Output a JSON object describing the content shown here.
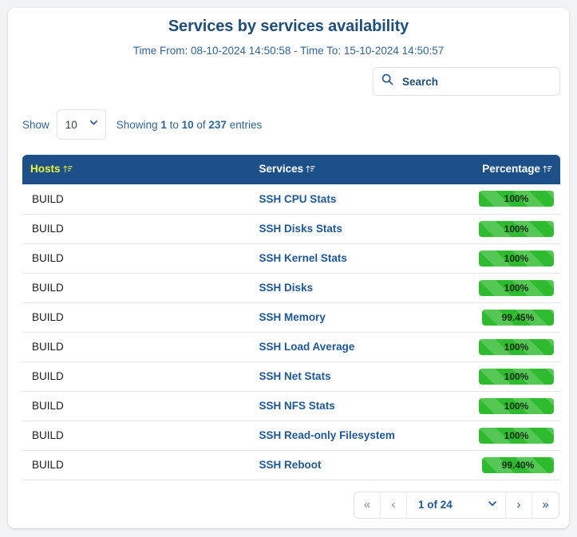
{
  "header": {
    "title": "Services by services availability",
    "time_range": "Time From: 08-10-2024 14:50:58 - Time To: 15-10-2024 14:50:57"
  },
  "search": {
    "placeholder": "Search",
    "value": "",
    "icon": "search-icon"
  },
  "controls": {
    "show_label": "Show",
    "page_length": "10",
    "showing_prefix": "Showing ",
    "showing_from": "1",
    "showing_mid": " to ",
    "showing_to": "10",
    "showing_of": " of ",
    "showing_total": "237",
    "showing_suffix": " entries"
  },
  "table": {
    "columns": [
      {
        "label": "Hosts",
        "sort_icon": "sort-amount-up-icon"
      },
      {
        "label": "Services",
        "sort_icon": "sort-amount-up-icon"
      },
      {
        "label": "Percentage",
        "sort_icon": "sort-amount-up-icon"
      }
    ],
    "rows": [
      {
        "host": "BUILD",
        "service": "SSH CPU Stats",
        "percentage": "100%",
        "value": 100
      },
      {
        "host": "BUILD",
        "service": "SSH Disks Stats",
        "percentage": "100%",
        "value": 100
      },
      {
        "host": "BUILD",
        "service": "SSH Kernel Stats",
        "percentage": "100%",
        "value": 100
      },
      {
        "host": "BUILD",
        "service": "SSH Disks",
        "percentage": "100%",
        "value": 100
      },
      {
        "host": "BUILD",
        "service": "SSH Memory",
        "percentage": "99.45%",
        "value": 99.45
      },
      {
        "host": "BUILD",
        "service": "SSH Load Average",
        "percentage": "100%",
        "value": 100
      },
      {
        "host": "BUILD",
        "service": "SSH Net Stats",
        "percentage": "100%",
        "value": 100
      },
      {
        "host": "BUILD",
        "service": "SSH NFS Stats",
        "percentage": "100%",
        "value": 100
      },
      {
        "host": "BUILD",
        "service": "SSH Read-only Filesystem",
        "percentage": "100%",
        "value": 100
      },
      {
        "host": "BUILD",
        "service": "SSH Reboot",
        "percentage": "99.40%",
        "value": 99.4
      }
    ]
  },
  "pagination": {
    "first_icon": "«",
    "prev_icon": "‹",
    "page_label": "1 of 24",
    "next_icon": "›",
    "last_icon": "»",
    "current_page": 1,
    "total_pages": 24
  },
  "colors": {
    "header_bg": "#1d5089",
    "header_sort_active": "#e9f53c",
    "title": "#1e4e79",
    "link": "#1e5799",
    "bar_green": "#2fbb2f"
  }
}
